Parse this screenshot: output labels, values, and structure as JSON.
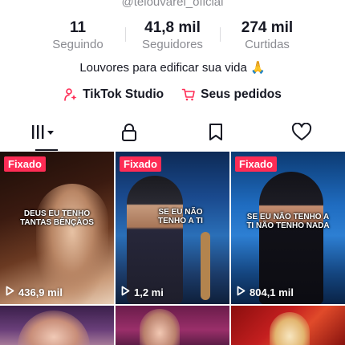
{
  "profile": {
    "handle": "@telouvarei_oficial",
    "bio": "Louvores para edificar sua vida 🙏",
    "stats": [
      {
        "value": "11",
        "label": "Seguindo"
      },
      {
        "value": "41,8 mil",
        "label": "Seguidores"
      },
      {
        "value": "274 mil",
        "label": "Curtidas"
      }
    ],
    "links": [
      {
        "label": "TikTok Studio",
        "icon": "tiktok-studio-icon"
      },
      {
        "label": "Seus pedidos",
        "icon": "cart-icon"
      }
    ]
  },
  "tabs": [
    {
      "name": "videos",
      "icon": "grid-icon",
      "active": true
    },
    {
      "name": "private",
      "icon": "lock-icon",
      "active": false
    },
    {
      "name": "favorites",
      "icon": "bookmark-icon",
      "active": false
    },
    {
      "name": "liked",
      "icon": "heart-icon",
      "active": false
    }
  ],
  "videos": [
    {
      "pinned_label": "Fixado",
      "caption_lines": [
        "Deus eu tenho",
        "tantas bênçãos"
      ],
      "views": "436,9 mil"
    },
    {
      "pinned_label": "Fixado",
      "caption_lines": [
        "Se eu não",
        "tenho a Ti"
      ],
      "views": "1,2 mi"
    },
    {
      "pinned_label": "Fixado",
      "caption_lines": [
        "Se eu não tenho a",
        "Ti não tenho nada"
      ],
      "views": "804,1 mil"
    },
    {
      "pinned_label": "",
      "caption_lines": [],
      "views": ""
    },
    {
      "pinned_label": "",
      "caption_lines": [],
      "views": ""
    },
    {
      "pinned_label": "",
      "caption_lines": [],
      "views": ""
    }
  ],
  "colors": {
    "accent": "#fe2c55",
    "text": "#161823",
    "muted": "#8a8b91"
  }
}
